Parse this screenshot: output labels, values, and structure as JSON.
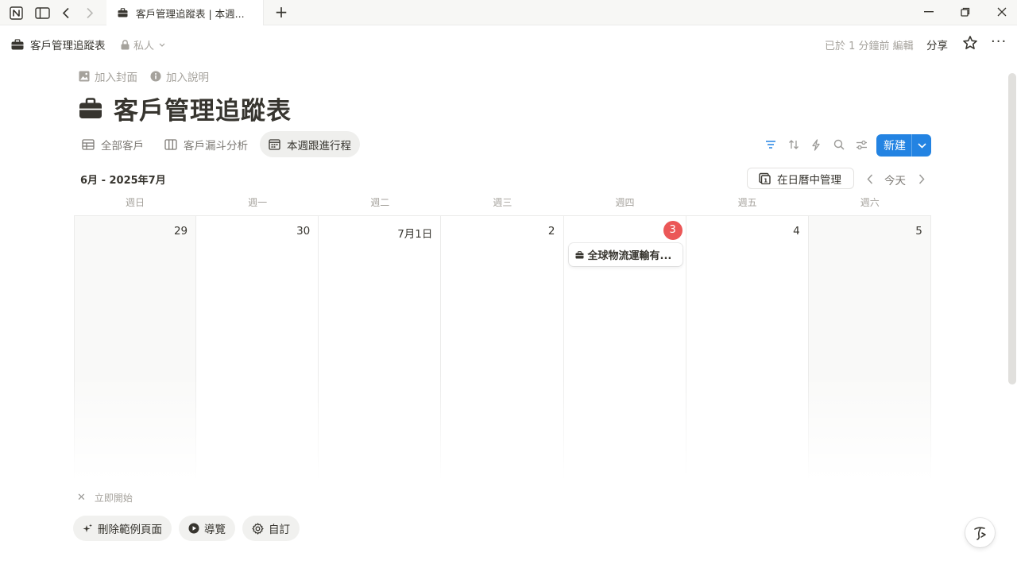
{
  "window": {
    "tab_title": "客戶管理追蹤表 | 本週...",
    "new_tab": "+",
    "minimize": "−"
  },
  "header": {
    "breadcrumb": "客戶管理追蹤表",
    "privacy": "私人",
    "edited": "已於 1 分鐘前 編輯",
    "share": "分享",
    "more": "···"
  },
  "page": {
    "add_cover": "加入封面",
    "add_description": "加入說明",
    "title": "客戶管理追蹤表"
  },
  "views": [
    {
      "label": "全部客戶",
      "icon": "table-icon"
    },
    {
      "label": "客戶漏斗分析",
      "icon": "board-icon"
    },
    {
      "label": "本週跟進行程",
      "icon": "calendar-icon",
      "active": true
    }
  ],
  "toolbar": {
    "new_label": "新建"
  },
  "calendar": {
    "month": "6月 - 2025年7月",
    "manage_label": "在日曆中管理",
    "today_label": "今天",
    "weekdays": [
      "週日",
      "週一",
      "週二",
      "週三",
      "週四",
      "週五",
      "週六"
    ],
    "days": [
      "29",
      "30",
      "7月1日",
      "2",
      "3",
      "4",
      "5"
    ],
    "today_index": 4,
    "event": {
      "day": "3",
      "title": "全球物流運輸有..."
    }
  },
  "footer": {
    "get_started": "立即開始",
    "chips": [
      {
        "label": "刪除範例頁面",
        "icon": "sparkle-icon"
      },
      {
        "label": "導覽",
        "icon": "play-icon"
      },
      {
        "label": "自訂",
        "icon": "gear-icon"
      }
    ]
  },
  "colors": {
    "accent": "#2383e2",
    "today_badge": "#eb5757",
    "text": "#37352f",
    "muted": "#a5a29c"
  }
}
